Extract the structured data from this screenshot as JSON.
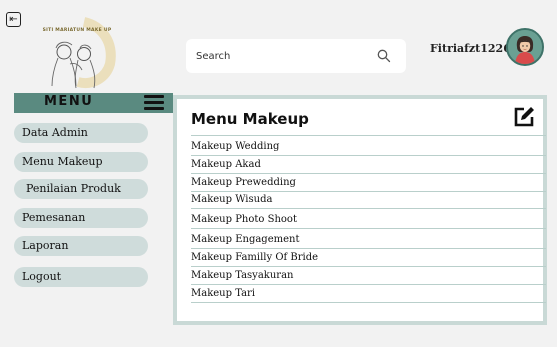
{
  "header": {
    "logo_text": "SITI MARIATUN MAKE UP",
    "search": {
      "placeholder": "Search",
      "value": ""
    },
    "username": "Fitriafzt1226"
  },
  "sidebar": {
    "title": "MENU",
    "items": [
      {
        "label": "Data Admin"
      },
      {
        "label": "Menu Makeup"
      },
      {
        "label": "Penilaian Produk"
      },
      {
        "label": "Pemesanan"
      },
      {
        "label": "Laporan"
      },
      {
        "label": "Logout"
      }
    ]
  },
  "main": {
    "title": "Menu Makeup",
    "items": [
      {
        "label": "Makeup Wedding"
      },
      {
        "label": "Makeup Akad"
      },
      {
        "label": "Makeup Prewedding"
      },
      {
        "label": "Makeup Wisuda"
      },
      {
        "label": "Makeup Photo Shoot"
      },
      {
        "label": "Makeup Engagement"
      },
      {
        "label": "Makeup Familly Of Bride"
      },
      {
        "label": "Makeup Tasyakuran"
      },
      {
        "label": "Makeup Tari"
      }
    ]
  },
  "colors": {
    "accent": "#5a8a80",
    "nav_bg": "#cfdcdb",
    "panel_border": "#c9d9d6",
    "background": "#f2f2f2"
  },
  "icons": {
    "back": "back-arrow-icon",
    "search": "search-icon",
    "menu": "hamburger-icon",
    "edit": "edit-icon",
    "avatar": "user-avatar"
  }
}
